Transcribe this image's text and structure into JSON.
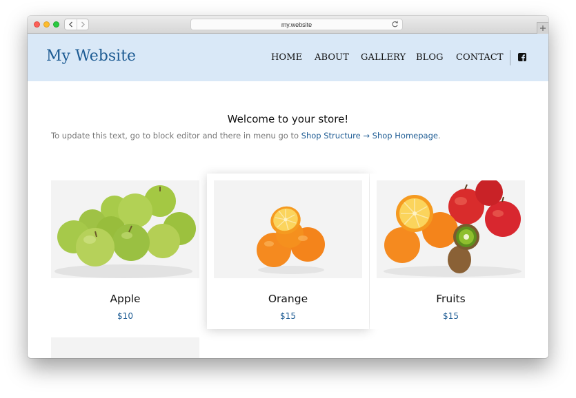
{
  "browser": {
    "url": "my.website"
  },
  "site": {
    "logo": "My Website",
    "nav": [
      "HOME",
      "ABOUT",
      "GALLERY",
      "BLOG",
      "CONTACT"
    ],
    "social_icon": "facebook-icon"
  },
  "store": {
    "welcome": "Welcome to your store!",
    "hint_prefix": "To update this text, go to block editor and there in menu go to ",
    "hint_link": "Shop Structure → Shop Homepage",
    "hint_suffix": "."
  },
  "products": [
    {
      "name": "Apple",
      "price": "$10"
    },
    {
      "name": "Orange",
      "price": "$15"
    },
    {
      "name": "Fruits",
      "price": "$15"
    }
  ],
  "colors": {
    "header_bg": "#d9e8f7",
    "brand": "#1d5b93"
  }
}
